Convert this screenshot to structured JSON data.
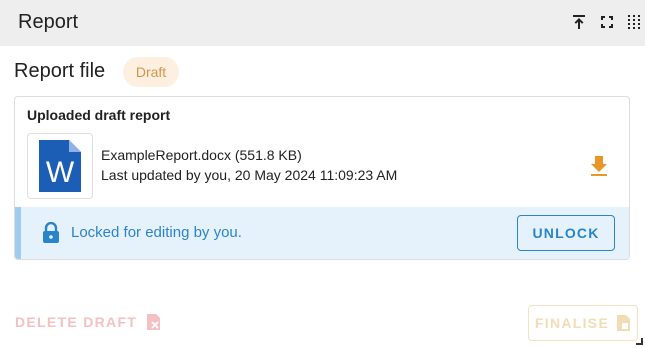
{
  "header": {
    "title": "Report",
    "icons": [
      "collapse-up-icon",
      "fullscreen-icon",
      "drag-grid-icon"
    ]
  },
  "heading": {
    "title": "Report file",
    "status_badge": "Draft"
  },
  "card": {
    "title": "Uploaded draft report",
    "file": {
      "icon": "word-document-icon",
      "name_line": "ExampleReport.docx (551.8 KB)",
      "meta_line": "Last updated by you, 20 May 2024 11:09:23 AM"
    },
    "download_icon": "download-icon",
    "lock_banner": {
      "icon": "lock-icon",
      "text": "Locked for editing by you.",
      "unlock_label": "UNLOCK"
    }
  },
  "actions": {
    "delete_label": "DELETE DRAFT",
    "delete_icon": "delete-file-icon",
    "finalise_label": "FINALISE",
    "finalise_icon": "finalise-file-icon"
  },
  "colors": {
    "header_bg": "#eeeeee",
    "accent_blue": "#2a84c9",
    "banner_bg": "#e6f2fb",
    "badge_bg": "#fdf0e1",
    "badge_text": "#d4954a",
    "download_orange": "#e8952a",
    "word_blue": "#1c5db5"
  }
}
